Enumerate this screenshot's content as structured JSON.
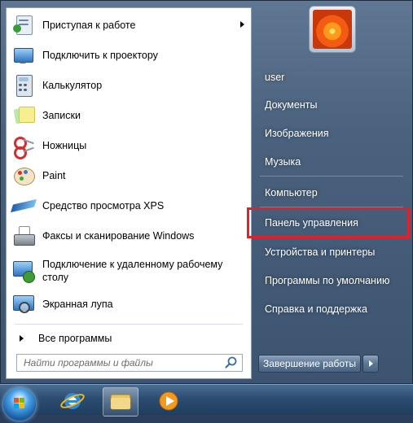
{
  "left_pane": {
    "programs": [
      {
        "label": "Приступая к работе",
        "icon": "getting-started-icon",
        "has_submenu": true
      },
      {
        "label": "Подключить к проектору",
        "icon": "projector-icon"
      },
      {
        "label": "Калькулятор",
        "icon": "calculator-icon"
      },
      {
        "label": "Записки",
        "icon": "sticky-notes-icon"
      },
      {
        "label": "Ножницы",
        "icon": "scissors-icon"
      },
      {
        "label": "Paint",
        "icon": "paint-icon"
      },
      {
        "label": "Средство просмотра XPS",
        "icon": "xps-viewer-icon"
      },
      {
        "label": "Факсы и сканирование Windows",
        "icon": "fax-scan-icon"
      },
      {
        "label": "Подключение к удаленному рабочему столу",
        "icon": "remote-desktop-icon"
      },
      {
        "label": "Экранная лупа",
        "icon": "magnifier-icon"
      }
    ],
    "all_programs_label": "Все программы",
    "search_placeholder": "Найти программы и файлы"
  },
  "right_pane": {
    "links": [
      {
        "label": "user"
      },
      {
        "label": "Документы"
      },
      {
        "label": "Изображения"
      },
      {
        "label": "Музыка"
      },
      {
        "label": "Компьютер"
      },
      {
        "label": "Панель управления",
        "highlighted": true
      },
      {
        "label": "Устройства и принтеры"
      },
      {
        "label": "Программы по умолчанию"
      },
      {
        "label": "Справка и поддержка"
      }
    ],
    "shutdown_label": "Завершение работы"
  },
  "taskbar": {
    "items": [
      "start-orb",
      "internet-explorer-icon",
      "windows-explorer-icon",
      "media-player-icon"
    ]
  },
  "colors": {
    "highlight_border": "#e0212b",
    "menu_bg": "#4a627e"
  }
}
